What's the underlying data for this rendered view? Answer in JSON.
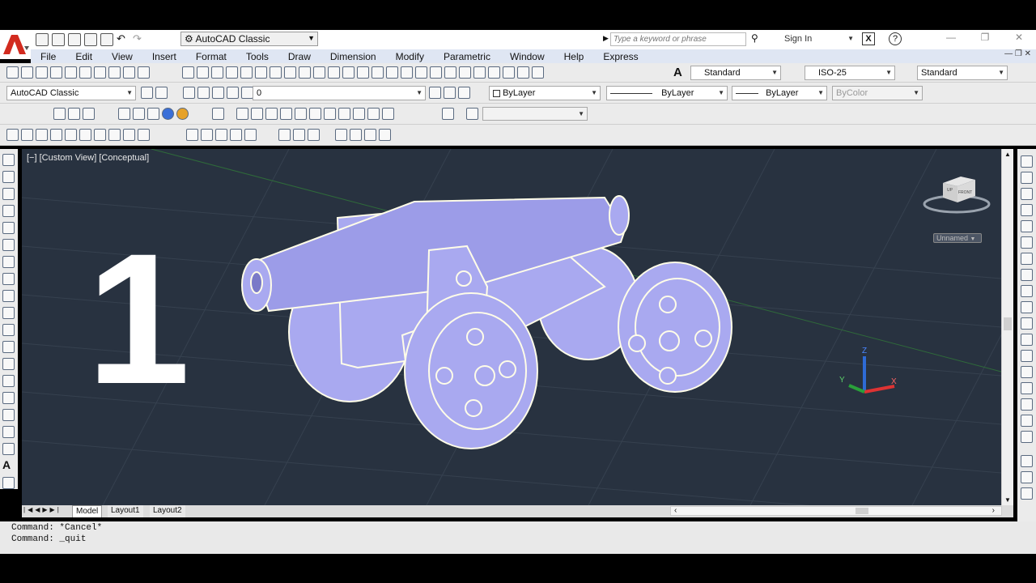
{
  "quick_access": {
    "workspace": "AutoCAD Classic"
  },
  "search": {
    "placeholder": "Type a keyword or phrase"
  },
  "signin_label": "Sign In",
  "help_label": "?",
  "xchange_label": "X",
  "menu": [
    "File",
    "Edit",
    "View",
    "Insert",
    "Format",
    "Tools",
    "Draw",
    "Dimension",
    "Modify",
    "Parametric",
    "Window",
    "Help",
    "Express"
  ],
  "styles": {
    "text_style": "Standard",
    "dim_style": "ISO-25",
    "table_style": "Standard"
  },
  "workspace_toolbar": {
    "workspace": "AutoCAD Classic",
    "layer": "0"
  },
  "properties": {
    "color": "ByLayer",
    "linetype": "ByLayer",
    "lineweight": "ByLayer",
    "plotstyle": "ByColor"
  },
  "viewport": {
    "label": "[−] [Custom View] [Conceptual]",
    "overlay_number": "1",
    "viewcube_label": "Unnamed",
    "viewcube_faces": {
      "up": "UP",
      "front": "FRONT"
    }
  },
  "axes": {
    "z": "Z",
    "y": "Y",
    "x": "X"
  },
  "tabs": [
    "Model",
    "Layout1",
    "Layout2"
  ],
  "commands": [
    "Command: *Cancel*",
    "Command: _quit"
  ],
  "colors": {
    "viewport_bg": "#283240",
    "model_fill": "#a9a9f0",
    "model_outline": "#fffde8",
    "menu_bg": "#dfe6f3"
  }
}
